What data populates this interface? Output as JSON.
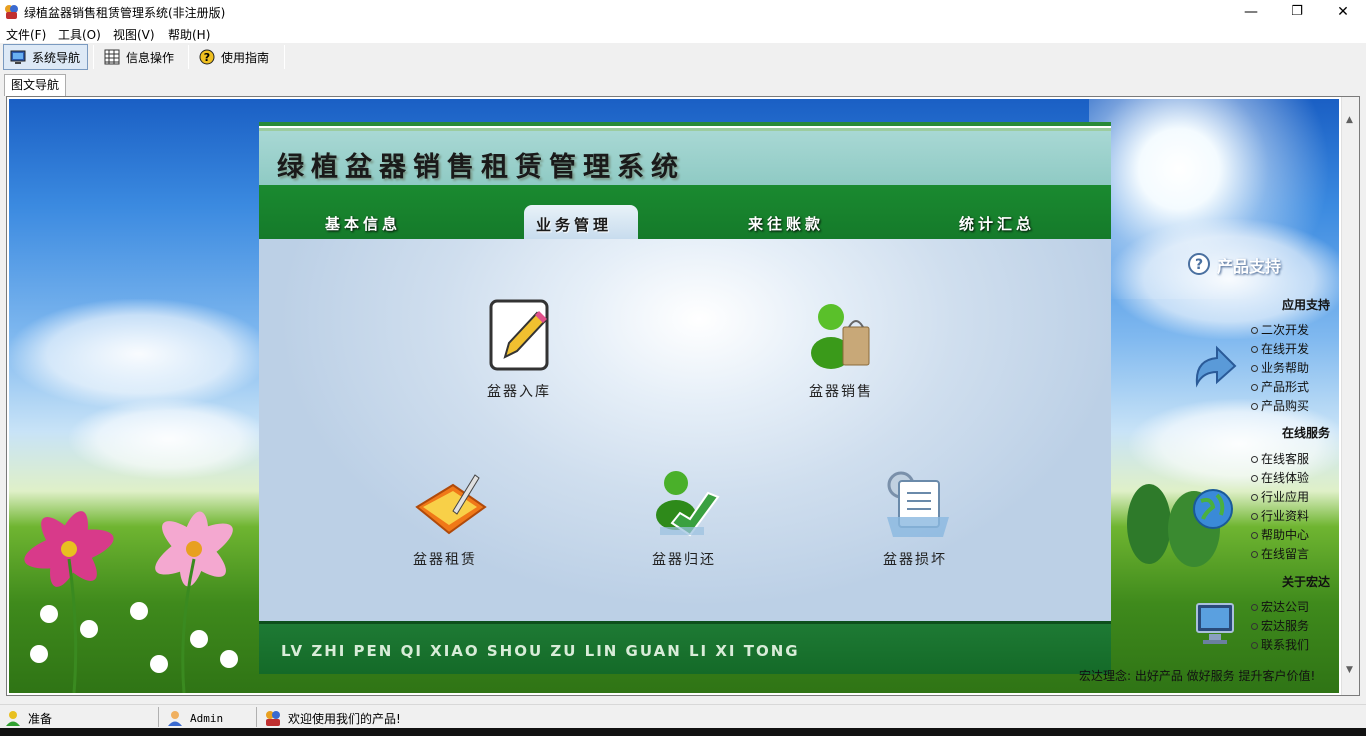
{
  "window": {
    "title": "绿植盆器销售租赁管理系统(非注册版)",
    "minimize": "—",
    "maximize": "❐",
    "close": "✕"
  },
  "menu": {
    "items": [
      "文件(F)",
      "工具(O)",
      "视图(V)",
      "帮助(H)"
    ]
  },
  "toolbar": {
    "nav": "系统导航",
    "info": "信息操作",
    "guide": "使用指南"
  },
  "tabs": {
    "active": "图文导航"
  },
  "panel": {
    "title": "绿植盆器销售租赁管理系统",
    "tabs": [
      "基本信息",
      "业务管理",
      "来往账款",
      "统计汇总"
    ],
    "active_tab": "业务管理",
    "modules": [
      "盆器入库",
      "盆器销售",
      "盆器租赁",
      "盆器归还",
      "盆器损坏"
    ],
    "footer": "LV ZHI PEN QI XIAO SHOU ZU LIN GUAN LI XI TONG"
  },
  "support": {
    "title": "产品支持",
    "app_head": "应用支持",
    "app_items": [
      "二次开发",
      "在线开发",
      "业务帮助",
      "产品形式",
      "产品购买"
    ],
    "online_head": "在线服务",
    "online_items": [
      "在线客服",
      "在线体验",
      "行业应用",
      "行业资料",
      "帮助中心",
      "在线留言"
    ],
    "about_head": "关于宏达",
    "about_items": [
      "宏达公司",
      "宏达服务",
      "联系我们"
    ],
    "slogan": "宏达理念: 出好产品  做好服务  提升客户价值!"
  },
  "status": {
    "ready": "准备",
    "user": "Admin",
    "welcome": "欢迎使用我们的产品!"
  },
  "colors": {
    "accent_green": "#157a2a",
    "header_teal": "#9fd2cd",
    "panel_body": "#c8dcee"
  }
}
